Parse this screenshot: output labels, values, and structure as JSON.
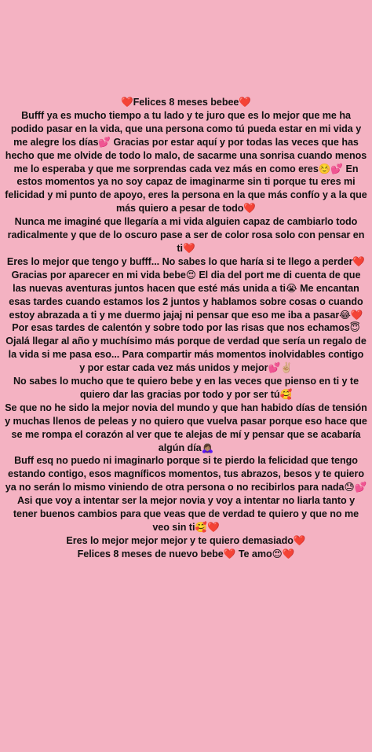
{
  "background_color": "#f4b2c2",
  "text_color": "#111111",
  "message": {
    "title": "❤️Felices 8 meses bebee❤️",
    "paragraphs": [
      "Bufff ya es mucho tiempo a tu lado y te juro que es lo mejor que me ha podido pasar en la vida, que una persona como tú pueda estar en mi vida y me alegre los días💕 Gracias por estar aquí y por todas las veces que has hecho que me olvide de todo lo malo, de sacarme una sonrisa cuando menos me lo esperaba y que me sorprendas cada vez más en como eres☺️💕 En estos momentos ya no soy capaz de imaginarme sin ti porque tu eres mi felicidad y mi punto de apoyo, eres la persona en la que más confío y a la que más quiero a pesar de todo❤️",
      "Nunca me imaginé que llegaría a mi vida alguien capaz de cambiarlo todo radicalmente y que de lo oscuro pase a ser de color rosa solo con pensar en ti❤️",
      "Eres lo mejor que tengo y bufff... No sabes lo que haría si te llego a perder❤️",
      "Gracias por aparecer en mi vida bebe😍 El dia del port me di cuenta de que las nuevas aventuras juntos hacen que esté más unida a ti😭 Me encantan esas tardes cuando estamos los 2 juntos y hablamos sobre cosas o cuando estoy abrazada a ti y me duermo jajaj ni pensar que eso me iba a pasar😂❤️ Por esas tardes de calentón y sobre todo por las risas que nos echamos😇",
      "Ojalá llegar al año y muchísimo más porque de verdad que sería un regalo de la vida si me pasa eso... Para compartir más momentos inolvidables contigo y por estar cada vez más unidos y mejor💕✌🏼",
      "No sabes lo mucho que te quiero bebe y en las veces que pienso en ti y te quiero dar las gracias por todo y por ser tú🥰",
      "Se que no he sido la mejor novia del mundo y que han habido días de tensión y muchas llenos de peleas y no quiero que vuelva pasar porque eso hace que se me rompa el corazón al ver que te alejas de mí y pensar que se acabaría algún día🙇🏽‍♀️",
      "Buff esq no puedo ni imaginarlo porque si te pierdo la felicidad que tengo estando contigo, esos magníficos momentos, tus abrazos, besos y te quiero ya no serán lo mismo viniendo de otra persona o no recibirlos para nada😓💕",
      "Asi que voy a intentar ser la mejor novia y voy a intentar no liarla tanto y tener buenos cambios para que veas que de verdad te quiero y que no me veo sin ti🥰❤️",
      "Eres lo mejor mejor mejor y te quiero demasiado❤️",
      "Felices 8 meses de nuevo bebe❤️ Te amo😍❤️"
    ]
  }
}
